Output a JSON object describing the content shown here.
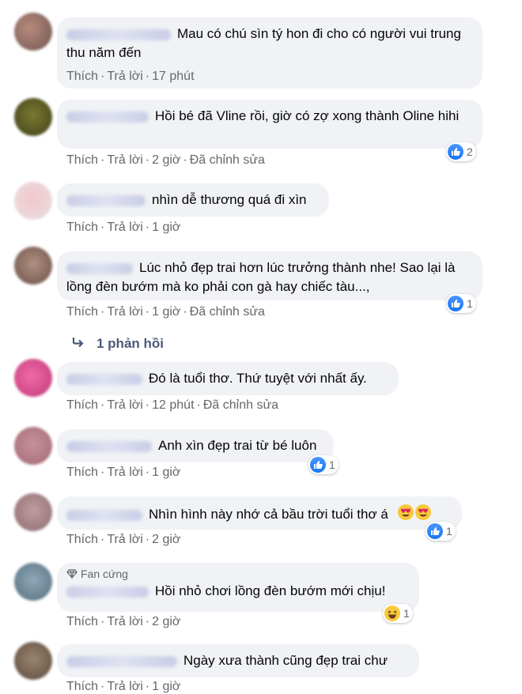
{
  "comments": [
    {
      "text": "Mau có chú sìn tý hon đi cho có người vui trung thu năm đến",
      "like": "Thích",
      "reply": "Trả lời",
      "time": "17 phút",
      "edited": ""
    },
    {
      "text": "Hồi bé đã Vline rồi, giờ có zợ xong thành Oline hihi",
      "like": "Thích",
      "reply": "Trả lời",
      "time": "2 giờ",
      "edited": "Đã chỉnh sửa",
      "reactions": "2"
    },
    {
      "text": "nhìn dễ thương quá đi xìn",
      "like": "Thích",
      "reply": "Trả lời",
      "time": "1 giờ",
      "edited": ""
    },
    {
      "text": "Lúc nhỏ đẹp trai hơn lúc trưởng thành nhe! Sao lại là lồng đèn bướm mà ko phải con gà hay chiếc tàu...,",
      "like": "Thích",
      "reply": "Trả lời",
      "time": "1 giờ",
      "edited": "Đã chỉnh sửa",
      "reactions": "1"
    },
    {
      "text": "Đó là tuổi thơ. Thứ tuyệt với nhất ấy.",
      "like": "Thích",
      "reply": "Trả lời",
      "time": "12 phút",
      "edited": "Đã chỉnh sửa"
    },
    {
      "text": "Anh xìn đẹp trai từ bé luôn",
      "like": "Thích",
      "reply": "Trả lời",
      "time": "1 giờ",
      "edited": "",
      "reactions": "1"
    },
    {
      "text": "Nhìn hình này nhớ cả bầu trời tuổi thơ á",
      "like": "Thích",
      "reply": "Trả lời",
      "time": "2 giờ",
      "edited": "",
      "reactions": "1"
    },
    {
      "badge": "Fan cứng",
      "text": "Hồi nhỏ chơi lồng đèn bướm mới chịu!",
      "like": "Thích",
      "reply": "Trả lời",
      "time": "2 giờ",
      "edited": "",
      "reactions": "1"
    },
    {
      "text": "Ngày xưa thành cũng đẹp trai chư",
      "like": "Thích",
      "reply": "Trả lời",
      "time": "1 giờ",
      "edited": ""
    }
  ],
  "replies_link": "1 phản hồi",
  "colors": {
    "bubble": "#f0f2f5",
    "meta": "#65676b",
    "like_blue": "#1877f2",
    "reply_link": "#4a5b78"
  }
}
